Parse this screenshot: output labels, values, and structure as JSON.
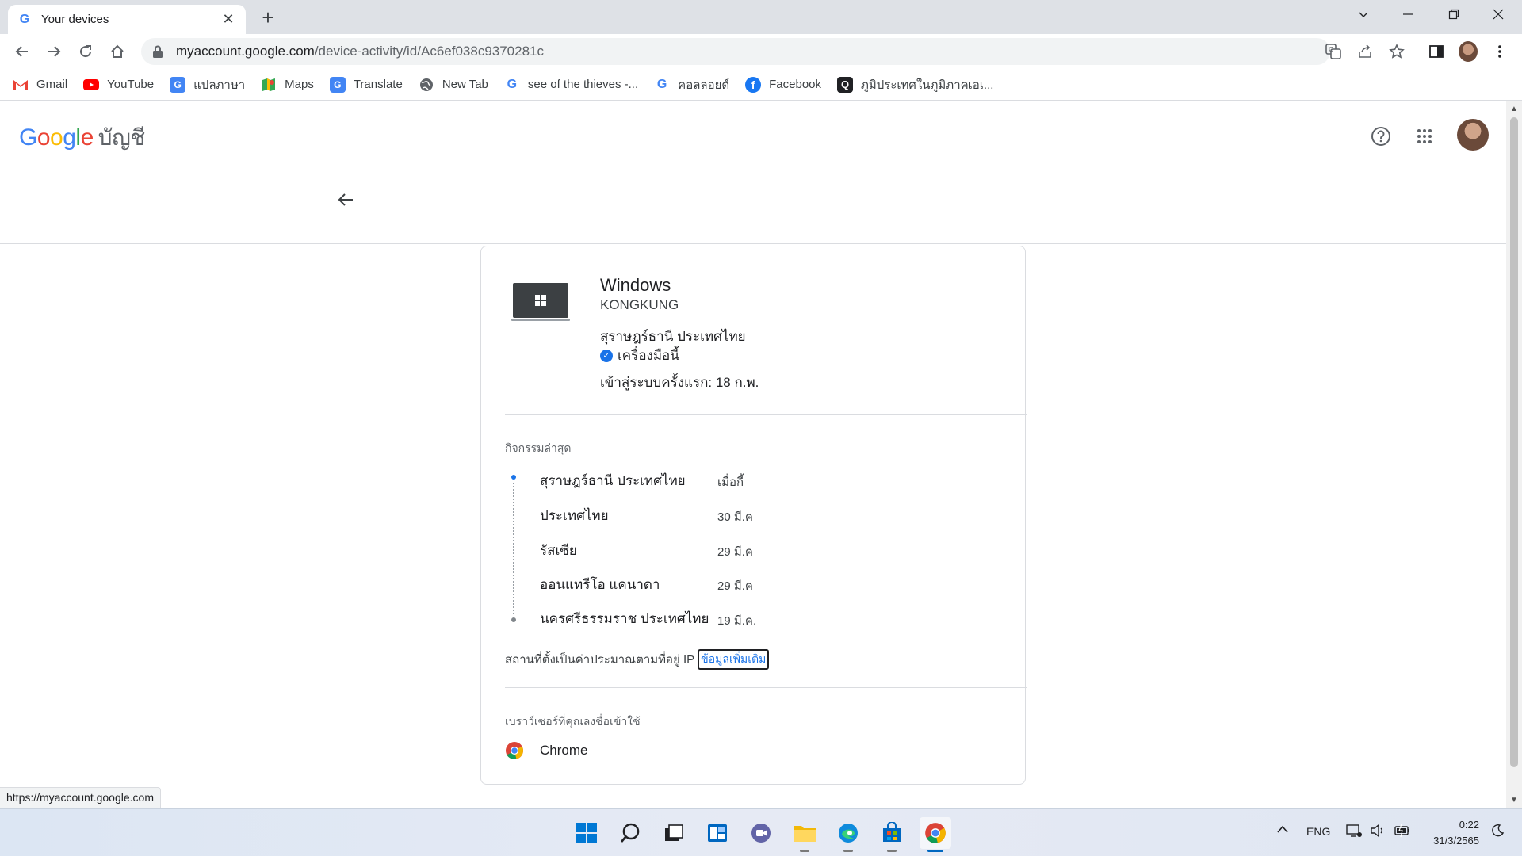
{
  "browser": {
    "tab_title": "Your devices",
    "url_host": "myaccount.google.com",
    "url_path": "/device-activity/id/Ac6ef038c9370281c"
  },
  "bookmarks": [
    {
      "label": "Gmail",
      "icon": "gmail-icon",
      "color": "#ea4335"
    },
    {
      "label": "YouTube",
      "icon": "youtube-icon",
      "color": "#ff0000"
    },
    {
      "label": "แปลภาษา",
      "icon": "translate-icon",
      "color": "#4285f4"
    },
    {
      "label": "Maps",
      "icon": "maps-icon",
      "color": "#34a853"
    },
    {
      "label": "Translate",
      "icon": "translate-icon",
      "color": "#4285f4"
    },
    {
      "label": "New Tab",
      "icon": "globe-icon",
      "color": "#5f6368"
    },
    {
      "label": "see of the thieves -...",
      "icon": "google-icon",
      "color": "#4285f4"
    },
    {
      "label": "คอลลอยด์",
      "icon": "google-icon",
      "color": "#4285f4"
    },
    {
      "label": "Facebook",
      "icon": "facebook-icon",
      "color": "#1877f2"
    },
    {
      "label": "ภูมิประเทศในภูมิภาคเอเ...",
      "icon": "quizlet-icon",
      "color": "#202124"
    }
  ],
  "header": {
    "logo": "Google",
    "account_label": "บัญชี"
  },
  "device": {
    "name": "Windows",
    "host": "KONGKUNG",
    "location": "สุราษฎร์ธานี ประเทศไทย",
    "this_device": "เครื่องมือนี้",
    "first_signin": "เข้าสู่ระบบครั้งแรก: 18 ก.พ."
  },
  "activity": {
    "label": "กิจกรรมล่าสุด",
    "items": [
      {
        "place": "สุราษฎร์ธานี ประเทศไทย",
        "date": "เมื่อกี้"
      },
      {
        "place": "ประเทศไทย",
        "date": "30 มี.ค"
      },
      {
        "place": "รัสเซีย",
        "date": "29 มี.ค"
      },
      {
        "place": "ออนแทรีโอ แคนาดา",
        "date": "29 มี.ค"
      },
      {
        "place": "นครศรีธรรมราช ประเทศไทย",
        "date": "19 มี.ค."
      }
    ],
    "ip_note": "สถานที่ตั้งเป็นค่าประมาณตามที่อยู่ IP",
    "more_link": "ข้อมูลเพิ่มเติม"
  },
  "browsers": {
    "label": "เบราว์เซอร์ที่คุณลงชื่อเข้าใช้",
    "items": [
      {
        "name": "Chrome"
      }
    ]
  },
  "status_url": "https://myaccount.google.com",
  "taskbar": {
    "lang": "ENG",
    "time": "0:22",
    "date": "31/3/2565"
  },
  "colors": {
    "accent": "#1a73e8",
    "activity_dot_current": "#1a73e8",
    "activity_dot_past": "#80868b"
  }
}
